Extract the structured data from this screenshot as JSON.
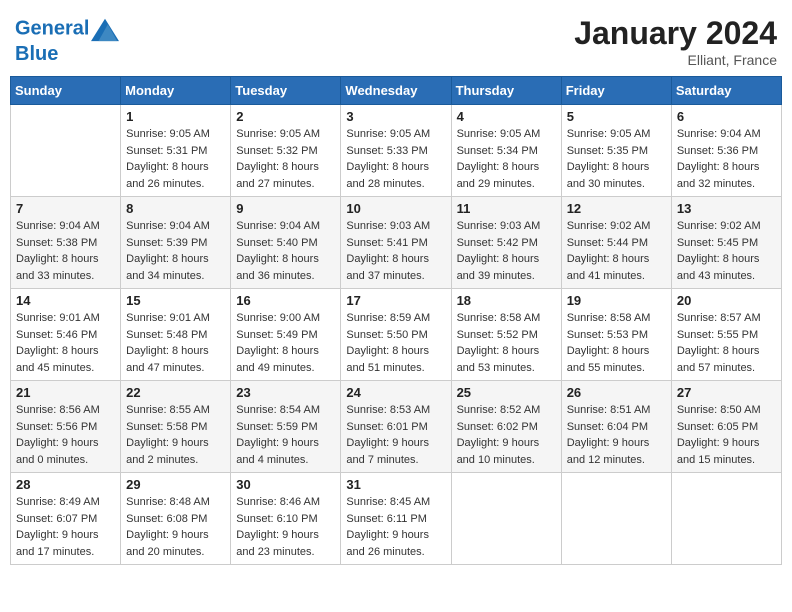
{
  "header": {
    "logo_line1": "General",
    "logo_line2": "Blue",
    "month": "January 2024",
    "location": "Elliant, France"
  },
  "days_of_week": [
    "Sunday",
    "Monday",
    "Tuesday",
    "Wednesday",
    "Thursday",
    "Friday",
    "Saturday"
  ],
  "weeks": [
    [
      {
        "day": "",
        "sunrise": "",
        "sunset": "",
        "daylight": ""
      },
      {
        "day": "1",
        "sunrise": "Sunrise: 9:05 AM",
        "sunset": "Sunset: 5:31 PM",
        "daylight": "Daylight: 8 hours and 26 minutes."
      },
      {
        "day": "2",
        "sunrise": "Sunrise: 9:05 AM",
        "sunset": "Sunset: 5:32 PM",
        "daylight": "Daylight: 8 hours and 27 minutes."
      },
      {
        "day": "3",
        "sunrise": "Sunrise: 9:05 AM",
        "sunset": "Sunset: 5:33 PM",
        "daylight": "Daylight: 8 hours and 28 minutes."
      },
      {
        "day": "4",
        "sunrise": "Sunrise: 9:05 AM",
        "sunset": "Sunset: 5:34 PM",
        "daylight": "Daylight: 8 hours and 29 minutes."
      },
      {
        "day": "5",
        "sunrise": "Sunrise: 9:05 AM",
        "sunset": "Sunset: 5:35 PM",
        "daylight": "Daylight: 8 hours and 30 minutes."
      },
      {
        "day": "6",
        "sunrise": "Sunrise: 9:04 AM",
        "sunset": "Sunset: 5:36 PM",
        "daylight": "Daylight: 8 hours and 32 minutes."
      }
    ],
    [
      {
        "day": "7",
        "sunrise": "Sunrise: 9:04 AM",
        "sunset": "Sunset: 5:38 PM",
        "daylight": "Daylight: 8 hours and 33 minutes."
      },
      {
        "day": "8",
        "sunrise": "Sunrise: 9:04 AM",
        "sunset": "Sunset: 5:39 PM",
        "daylight": "Daylight: 8 hours and 34 minutes."
      },
      {
        "day": "9",
        "sunrise": "Sunrise: 9:04 AM",
        "sunset": "Sunset: 5:40 PM",
        "daylight": "Daylight: 8 hours and 36 minutes."
      },
      {
        "day": "10",
        "sunrise": "Sunrise: 9:03 AM",
        "sunset": "Sunset: 5:41 PM",
        "daylight": "Daylight: 8 hours and 37 minutes."
      },
      {
        "day": "11",
        "sunrise": "Sunrise: 9:03 AM",
        "sunset": "Sunset: 5:42 PM",
        "daylight": "Daylight: 8 hours and 39 minutes."
      },
      {
        "day": "12",
        "sunrise": "Sunrise: 9:02 AM",
        "sunset": "Sunset: 5:44 PM",
        "daylight": "Daylight: 8 hours and 41 minutes."
      },
      {
        "day": "13",
        "sunrise": "Sunrise: 9:02 AM",
        "sunset": "Sunset: 5:45 PM",
        "daylight": "Daylight: 8 hours and 43 minutes."
      }
    ],
    [
      {
        "day": "14",
        "sunrise": "Sunrise: 9:01 AM",
        "sunset": "Sunset: 5:46 PM",
        "daylight": "Daylight: 8 hours and 45 minutes."
      },
      {
        "day": "15",
        "sunrise": "Sunrise: 9:01 AM",
        "sunset": "Sunset: 5:48 PM",
        "daylight": "Daylight: 8 hours and 47 minutes."
      },
      {
        "day": "16",
        "sunrise": "Sunrise: 9:00 AM",
        "sunset": "Sunset: 5:49 PM",
        "daylight": "Daylight: 8 hours and 49 minutes."
      },
      {
        "day": "17",
        "sunrise": "Sunrise: 8:59 AM",
        "sunset": "Sunset: 5:50 PM",
        "daylight": "Daylight: 8 hours and 51 minutes."
      },
      {
        "day": "18",
        "sunrise": "Sunrise: 8:58 AM",
        "sunset": "Sunset: 5:52 PM",
        "daylight": "Daylight: 8 hours and 53 minutes."
      },
      {
        "day": "19",
        "sunrise": "Sunrise: 8:58 AM",
        "sunset": "Sunset: 5:53 PM",
        "daylight": "Daylight: 8 hours and 55 minutes."
      },
      {
        "day": "20",
        "sunrise": "Sunrise: 8:57 AM",
        "sunset": "Sunset: 5:55 PM",
        "daylight": "Daylight: 8 hours and 57 minutes."
      }
    ],
    [
      {
        "day": "21",
        "sunrise": "Sunrise: 8:56 AM",
        "sunset": "Sunset: 5:56 PM",
        "daylight": "Daylight: 9 hours and 0 minutes."
      },
      {
        "day": "22",
        "sunrise": "Sunrise: 8:55 AM",
        "sunset": "Sunset: 5:58 PM",
        "daylight": "Daylight: 9 hours and 2 minutes."
      },
      {
        "day": "23",
        "sunrise": "Sunrise: 8:54 AM",
        "sunset": "Sunset: 5:59 PM",
        "daylight": "Daylight: 9 hours and 4 minutes."
      },
      {
        "day": "24",
        "sunrise": "Sunrise: 8:53 AM",
        "sunset": "Sunset: 6:01 PM",
        "daylight": "Daylight: 9 hours and 7 minutes."
      },
      {
        "day": "25",
        "sunrise": "Sunrise: 8:52 AM",
        "sunset": "Sunset: 6:02 PM",
        "daylight": "Daylight: 9 hours and 10 minutes."
      },
      {
        "day": "26",
        "sunrise": "Sunrise: 8:51 AM",
        "sunset": "Sunset: 6:04 PM",
        "daylight": "Daylight: 9 hours and 12 minutes."
      },
      {
        "day": "27",
        "sunrise": "Sunrise: 8:50 AM",
        "sunset": "Sunset: 6:05 PM",
        "daylight": "Daylight: 9 hours and 15 minutes."
      }
    ],
    [
      {
        "day": "28",
        "sunrise": "Sunrise: 8:49 AM",
        "sunset": "Sunset: 6:07 PM",
        "daylight": "Daylight: 9 hours and 17 minutes."
      },
      {
        "day": "29",
        "sunrise": "Sunrise: 8:48 AM",
        "sunset": "Sunset: 6:08 PM",
        "daylight": "Daylight: 9 hours and 20 minutes."
      },
      {
        "day": "30",
        "sunrise": "Sunrise: 8:46 AM",
        "sunset": "Sunset: 6:10 PM",
        "daylight": "Daylight: 9 hours and 23 minutes."
      },
      {
        "day": "31",
        "sunrise": "Sunrise: 8:45 AM",
        "sunset": "Sunset: 6:11 PM",
        "daylight": "Daylight: 9 hours and 26 minutes."
      },
      {
        "day": "",
        "sunrise": "",
        "sunset": "",
        "daylight": ""
      },
      {
        "day": "",
        "sunrise": "",
        "sunset": "",
        "daylight": ""
      },
      {
        "day": "",
        "sunrise": "",
        "sunset": "",
        "daylight": ""
      }
    ]
  ]
}
